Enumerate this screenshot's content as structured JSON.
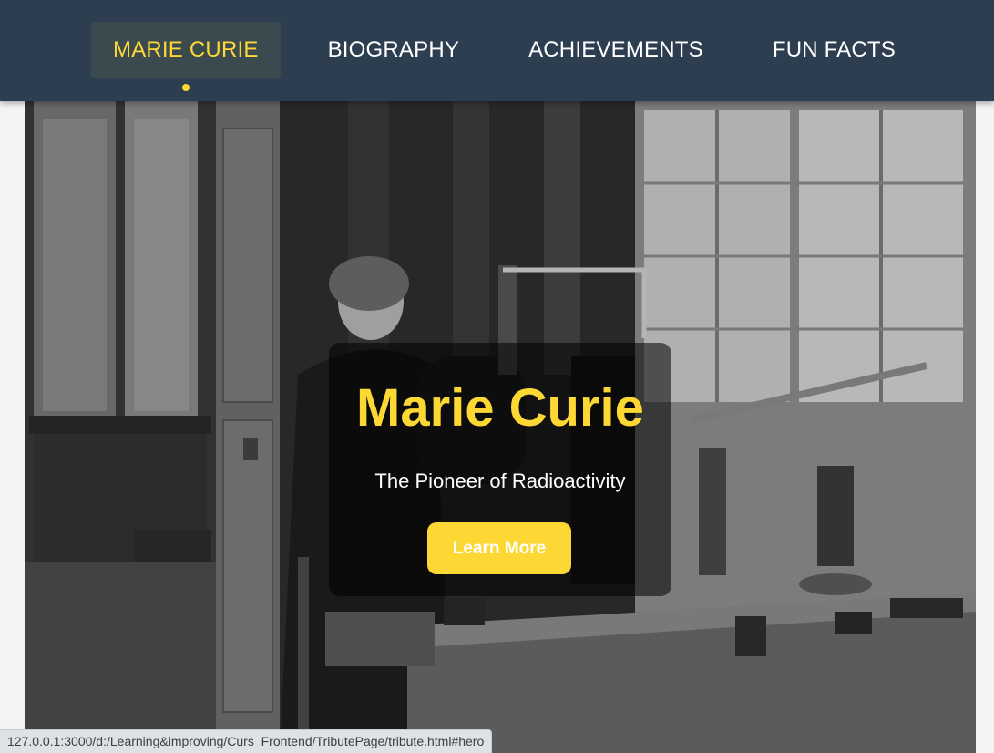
{
  "nav": {
    "items": [
      {
        "label": "MARIE CURIE",
        "active": true
      },
      {
        "label": "BIOGRAPHY",
        "active": false
      },
      {
        "label": "ACHIEVEMENTS",
        "active": false
      },
      {
        "label": "FUN FACTS",
        "active": false
      }
    ]
  },
  "hero": {
    "title": "Marie Curie",
    "subtitle": "The Pioneer of Radioactivity",
    "button_label": "Learn More"
  },
  "status_bar": {
    "url": "127.0.0.1:3000/d:/Learning&improving/Curs_Frontend/TributePage/tribute.html#hero"
  },
  "colors": {
    "nav_background": "#2c3e50",
    "accent": "#fdd835",
    "nav_text": "#ffffff",
    "active_item_background": "#3a4a4f"
  }
}
